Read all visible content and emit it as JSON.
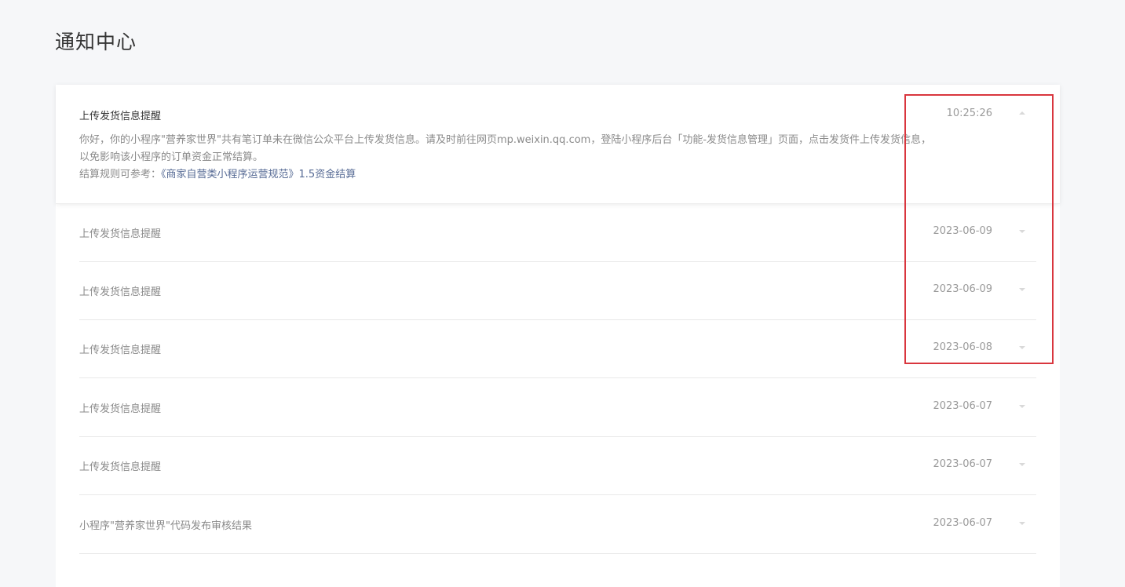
{
  "page": {
    "title": "通知中心"
  },
  "expanded_notification": {
    "title": "上传发货信息提醒",
    "time": "10:25:26",
    "body_line1": "你好，你的小程序\"营养家世界\"共有笔订单未在微信公众平台上传发货信息。请及时前往网页mp.weixin.qq.com，登陆小程序后台「功能-发货信息管理」页面，点击发货件上传发货信息，",
    "body_line2": "以免影响该小程序的订单资金正常结算。",
    "rule_prefix": "结算规则可参考：",
    "rule_link": "《商家自营类小程序运营规范》1.5资金结算",
    "collapse_icon": "chevron-up-icon"
  },
  "notifications": [
    {
      "title": "上传发货信息提醒",
      "date": "2023-06-09"
    },
    {
      "title": "上传发货信息提醒",
      "date": "2023-06-09"
    },
    {
      "title": "上传发货信息提醒",
      "date": "2023-06-08"
    },
    {
      "title": "上传发货信息提醒",
      "date": "2023-06-07"
    },
    {
      "title": "上传发货信息提醒",
      "date": "2023-06-07"
    },
    {
      "title": "小程序\"营养家世界\"代码发布审核结果",
      "date": "2023-06-07"
    }
  ],
  "colors": {
    "background": "#f6f7f9",
    "panel": "#ffffff",
    "link": "#576b95",
    "highlight": "#d9363e"
  }
}
